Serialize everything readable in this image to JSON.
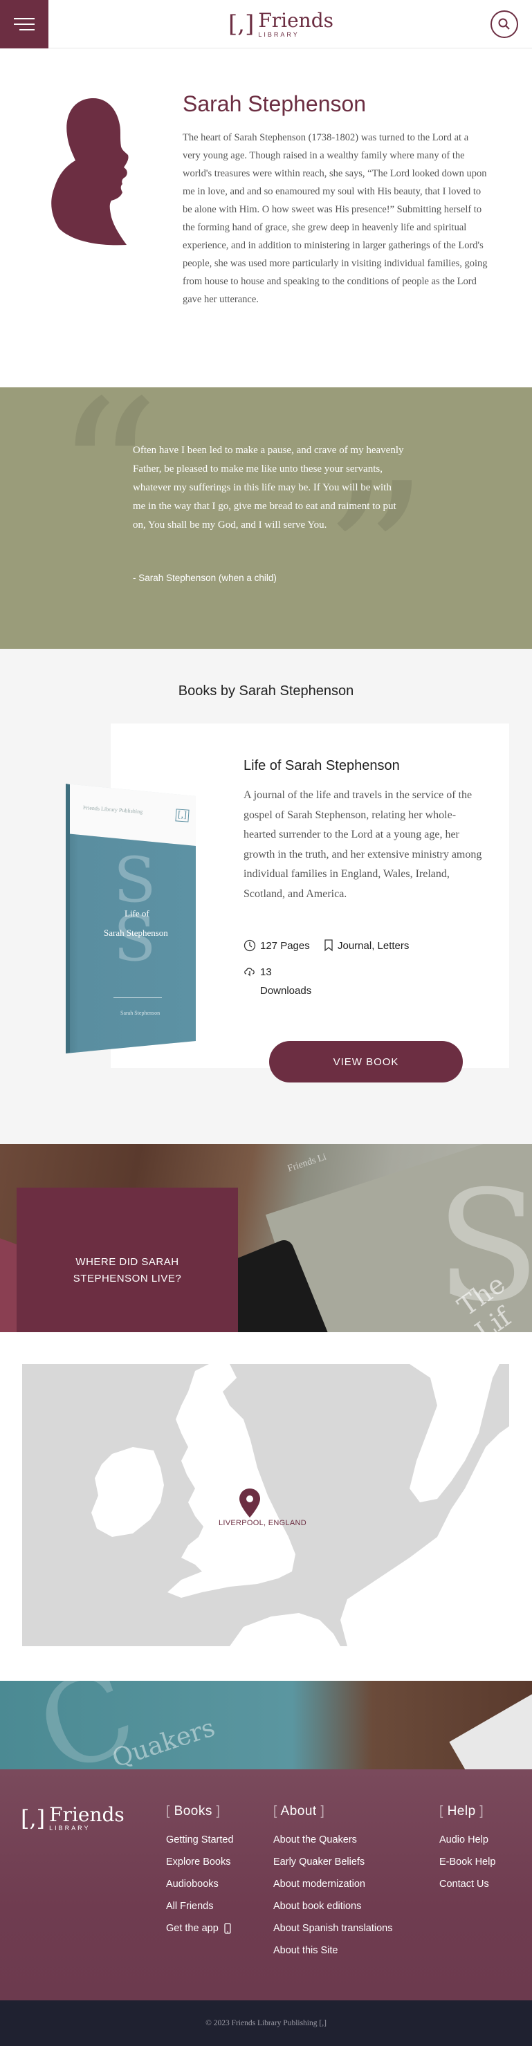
{
  "header": {
    "logo_mark": "[,]",
    "logo_name": "Friends",
    "logo_sub": "LIBRARY"
  },
  "bio": {
    "name": "Sarah Stephenson",
    "text": "The heart of Sarah Stephenson (1738-1802) was turned to the Lord at a very young age. Though raised in a wealthy family where many of the world's treasures were within reach, she says, “The Lord looked down upon me in love, and and so enamoured my soul with His beauty, that I loved to be alone with Him. O how sweet was His presence!” Submitting herself to the forming hand of grace, she grew deep in heavenly life and spiritual experience, and in addition to ministering in larger gatherings of the Lord's people, she was used more particularly in visiting individual families, going from house to house and speaking to the conditions of people as the Lord gave her utterance."
  },
  "quote": {
    "text": "Often have I been led to make a pause, and crave of my heavenly Father, be pleased to make me like unto these your servants, whatever my sufferings in this life may be. If You will be with me in the way that I go, give me bread to eat and raiment to put on, You shall be my God, and I will serve You.",
    "attribution": "- Sarah Stephenson (when a child)"
  },
  "books": {
    "section_title": "Books by Sarah Stephenson",
    "items": [
      {
        "title": "Life of Sarah Stephenson",
        "description": "A journal of the life and travels in the service of the gospel of Sarah Stephenson, relating her whole-hearted surrender to the Lord at a young age, her growth in the truth, and her extensive ministry among individual families in England, Wales, Ireland, Scotland, and America.",
        "pages": "127 Pages",
        "tags": "Journal, Letters",
        "downloads_count": "13",
        "downloads_label": "Downloads",
        "button": "VIEW BOOK",
        "cover": {
          "publisher": "Friends Library Publishing",
          "mark": "[,]",
          "letter": "S",
          "title_line1": "Life of",
          "title_line2": "Sarah Stephenson",
          "author": "Sarah Stephenson",
          "color": "#5a8ea0"
        }
      }
    ]
  },
  "banner": {
    "heading": "WHERE DID SARAH STEPHENSON LIVE?",
    "bg_book_letter": "S",
    "bg_book_title": "The Lif",
    "bg_book_publisher": "Friends Li"
  },
  "map": {
    "location_label": "LIVERPOOL, ENGLAND"
  },
  "strip": {
    "book_text": "Quakers",
    "book_letter": "C"
  },
  "footer": {
    "logo_mark": "[,]",
    "logo_name": "Friends",
    "logo_sub": "LIBRARY",
    "columns": [
      {
        "title": "Books",
        "links": [
          "Getting Started",
          "Explore Books",
          "Audiobooks",
          "All Friends",
          "Get the app"
        ]
      },
      {
        "title": "About",
        "links": [
          "About the Quakers",
          "Early Quaker Beliefs",
          "About modernization",
          "About book editions",
          "About Spanish translations",
          "About this Site"
        ]
      },
      {
        "title": "Help",
        "links": [
          "Audio Help",
          "E-Book Help",
          "Contact Us"
        ]
      }
    ]
  },
  "copyright": "© 2023 Friends Library Publishing [,]",
  "colors": {
    "brand": "#6c2e42",
    "quote_bg": "#9a9c7a",
    "footer_bg": "#6f3c50",
    "copyright_bg": "#1f2130",
    "map_land": "#ffffff",
    "map_water": "#d8d8d8"
  }
}
